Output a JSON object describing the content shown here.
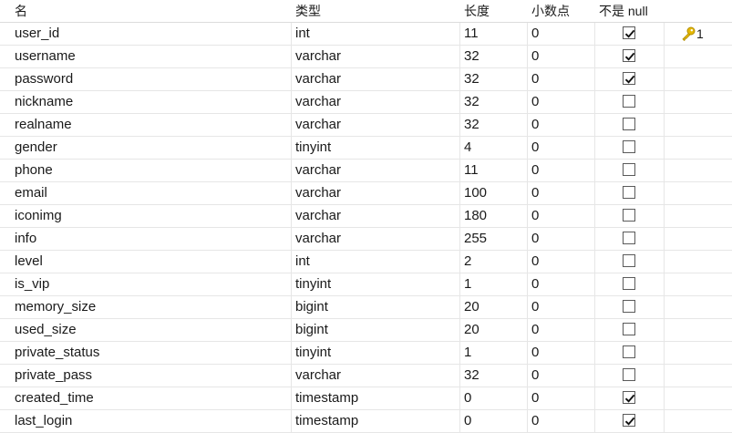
{
  "headers": {
    "name": "名",
    "type": "类型",
    "length": "长度",
    "decimals": "小数点",
    "not_null": "不是 null"
  },
  "rows": [
    {
      "name": "user_id",
      "type": "int",
      "length": "11",
      "decimals": "0",
      "not_null": true,
      "key": "1"
    },
    {
      "name": "username",
      "type": "varchar",
      "length": "32",
      "decimals": "0",
      "not_null": true,
      "key": ""
    },
    {
      "name": "password",
      "type": "varchar",
      "length": "32",
      "decimals": "0",
      "not_null": true,
      "key": ""
    },
    {
      "name": "nickname",
      "type": "varchar",
      "length": "32",
      "decimals": "0",
      "not_null": false,
      "key": ""
    },
    {
      "name": "realname",
      "type": "varchar",
      "length": "32",
      "decimals": "0",
      "not_null": false,
      "key": ""
    },
    {
      "name": "gender",
      "type": "tinyint",
      "length": "4",
      "decimals": "0",
      "not_null": false,
      "key": ""
    },
    {
      "name": "phone",
      "type": "varchar",
      "length": "11",
      "decimals": "0",
      "not_null": false,
      "key": ""
    },
    {
      "name": "email",
      "type": "varchar",
      "length": "100",
      "decimals": "0",
      "not_null": false,
      "key": ""
    },
    {
      "name": "iconimg",
      "type": "varchar",
      "length": "180",
      "decimals": "0",
      "not_null": false,
      "key": ""
    },
    {
      "name": "info",
      "type": "varchar",
      "length": "255",
      "decimals": "0",
      "not_null": false,
      "key": ""
    },
    {
      "name": "level",
      "type": "int",
      "length": "2",
      "decimals": "0",
      "not_null": false,
      "key": ""
    },
    {
      "name": "is_vip",
      "type": "tinyint",
      "length": "1",
      "decimals": "0",
      "not_null": false,
      "key": ""
    },
    {
      "name": "memory_size",
      "type": "bigint",
      "length": "20",
      "decimals": "0",
      "not_null": false,
      "key": ""
    },
    {
      "name": "used_size",
      "type": "bigint",
      "length": "20",
      "decimals": "0",
      "not_null": false,
      "key": ""
    },
    {
      "name": "private_status",
      "type": "tinyint",
      "length": "1",
      "decimals": "0",
      "not_null": false,
      "key": ""
    },
    {
      "name": "private_pass",
      "type": "varchar",
      "length": "32",
      "decimals": "0",
      "not_null": false,
      "key": ""
    },
    {
      "name": "created_time",
      "type": "timestamp",
      "length": "0",
      "decimals": "0",
      "not_null": true,
      "key": ""
    },
    {
      "name": "last_login",
      "type": "timestamp",
      "length": "0",
      "decimals": "0",
      "not_null": true,
      "key": ""
    }
  ],
  "icons": {
    "key": "key-icon",
    "check": "checkmark-icon"
  },
  "colors": {
    "key_gold": "#e6b800",
    "grid_line": "#e6e6e6",
    "check_border": "#5a5a5a"
  }
}
